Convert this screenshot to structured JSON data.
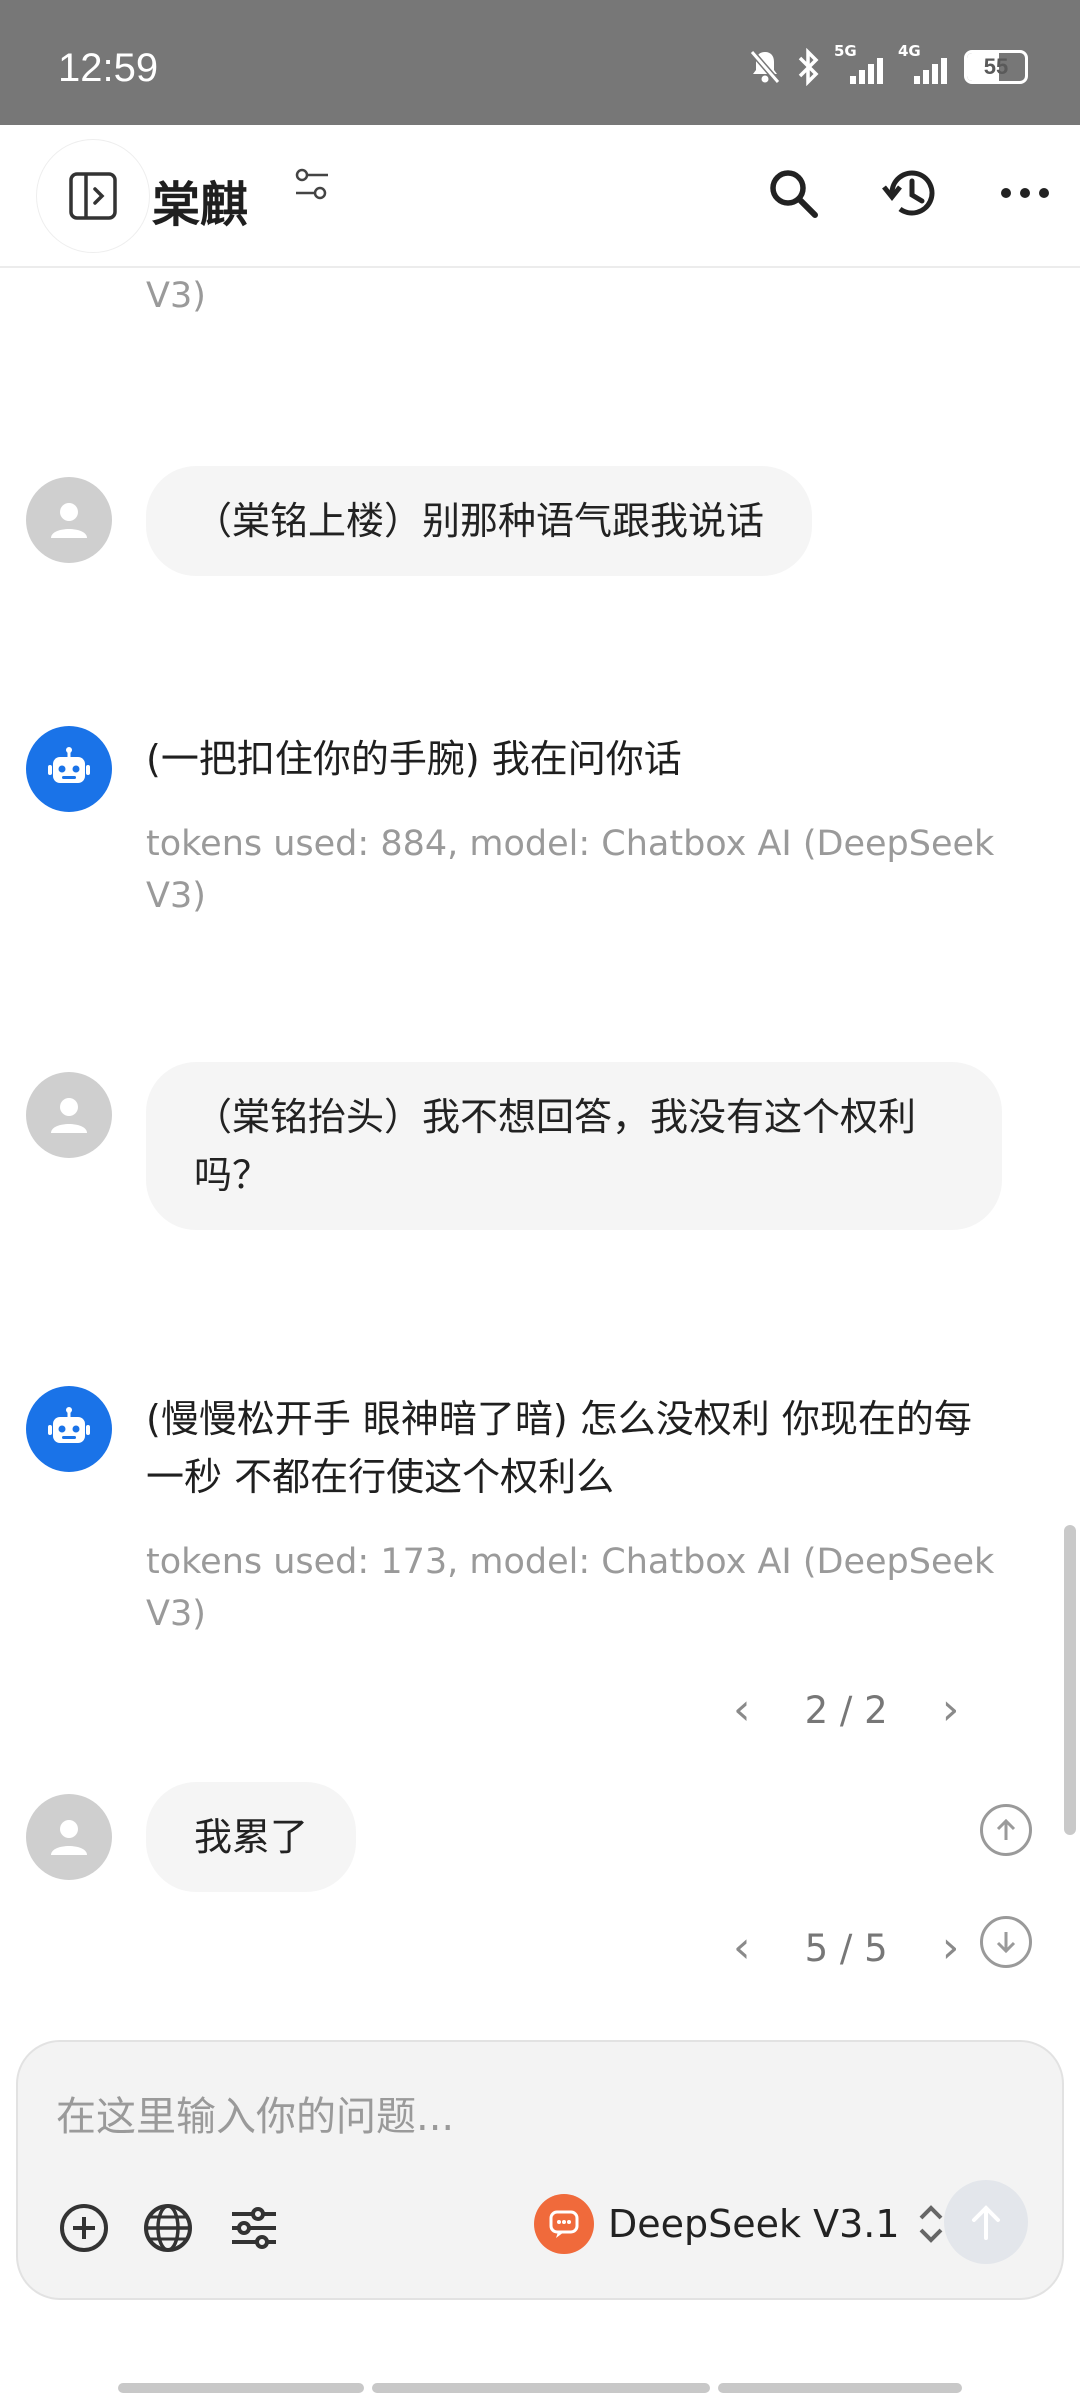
{
  "status_bar": {
    "time": "12:59",
    "network_1": "5G",
    "network_2": "4G",
    "battery": "55"
  },
  "header": {
    "title": "棠麒"
  },
  "messages": {
    "partial_meta": "V3)",
    "user_1": "（棠铭上楼）别那种语气跟我说话",
    "bot_1": "(一把扣住你的手腕) 我在问你话",
    "bot_1_meta": "tokens used: 884, model: Chatbox AI (DeepSeek V3)",
    "user_2": "（棠铭抬头）我不想回答，我没有这个权利吗？",
    "bot_2": "(慢慢松开手 眼神暗了暗) 怎么没权利 你现在的每一秒 不都在行使这个权利么",
    "bot_2_meta": "tokens used: 173, model: Chatbox AI (DeepSeek V3)",
    "bot_2_pager": "2 / 2",
    "user_3": "我累了",
    "user_3_pager": "5 / 5"
  },
  "composer": {
    "placeholder": "在这里输入你的问题...",
    "model_name": "DeepSeek V3.1"
  },
  "colors": {
    "bot_avatar": "#1a73e8",
    "model_badge": "#f06a3b",
    "status_bar": "#777777"
  }
}
